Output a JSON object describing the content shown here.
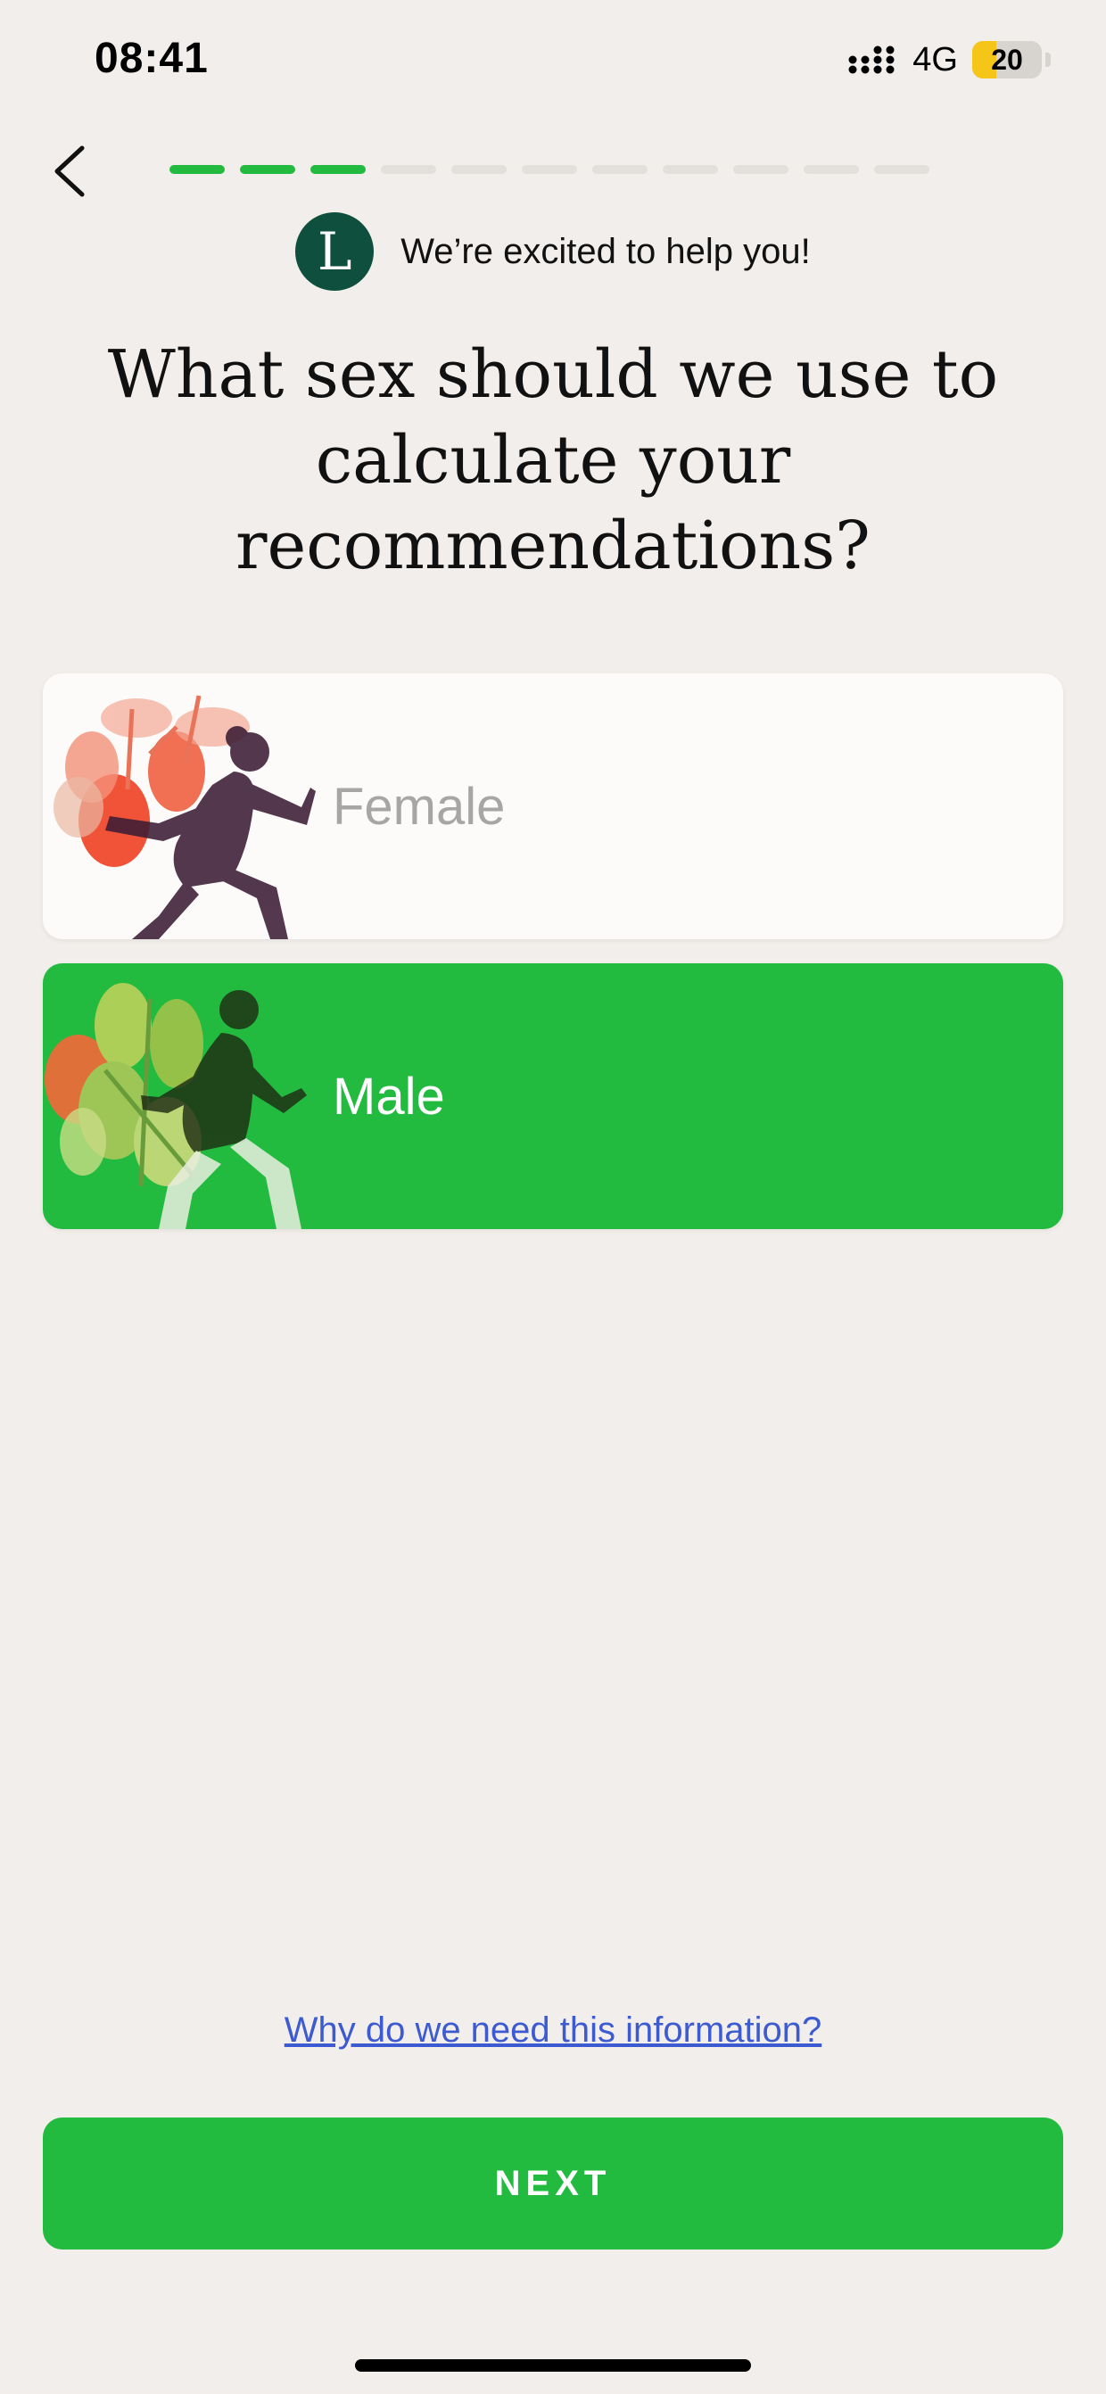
{
  "status_bar": {
    "time": "08:41",
    "network": "4G",
    "battery_level": "20",
    "battery_color": "#f5c518"
  },
  "progress": {
    "total_steps": 11,
    "completed_steps": 3,
    "active_color": "#22bb40"
  },
  "coach": {
    "logo_letter": "L",
    "message": "We’re excited to help you!"
  },
  "question": "What sex should we use to calculate your recommendations?",
  "options": [
    {
      "label": "Female",
      "selected": false
    },
    {
      "label": "Male",
      "selected": true
    }
  ],
  "help_link": "Why do we need this information?",
  "next_button": "NEXT",
  "colors": {
    "accent": "#22bb40",
    "background": "#f2eeeb",
    "link": "#3d5bd1",
    "logo": "#0e4f3d"
  }
}
